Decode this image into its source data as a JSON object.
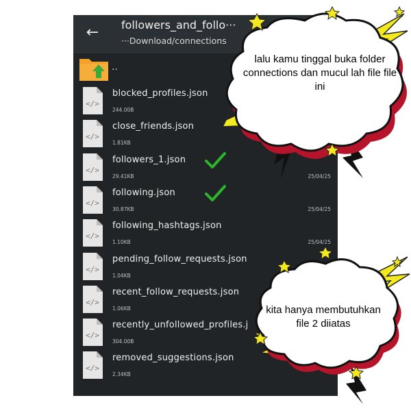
{
  "header": {
    "title": "followers_and_follo···",
    "path": "···Download/connections"
  },
  "parent": {
    "label": ".."
  },
  "files": [
    {
      "name": "blocked_profiles.json",
      "size": "244.00B",
      "date": ""
    },
    {
      "name": "close_friends.json",
      "size": "1.81KB",
      "date": ""
    },
    {
      "name": "followers_1.json",
      "size": "29.41KB",
      "date": "25/04/25",
      "checked": true
    },
    {
      "name": "following.json",
      "size": "30.87KB",
      "date": "25/04/25",
      "checked": true
    },
    {
      "name": "following_hashtags.json",
      "size": "1.10KB",
      "date": "25/04/25"
    },
    {
      "name": "pending_follow_requests.json",
      "size": "1.04KB",
      "date": ""
    },
    {
      "name": "recent_follow_requests.json",
      "size": "1.06KB",
      "date": ""
    },
    {
      "name": "recently_unfollowed_profiles.j",
      "size": "304.00B",
      "date": ""
    },
    {
      "name": "removed_suggestions.json",
      "size": "2.34KB",
      "date": ""
    }
  ],
  "callouts": [
    {
      "text": "lalu kamu tinggal buka folder connections dan mucul lah file file ini"
    },
    {
      "text": "kita hanya membutuhkan file 2 diiatas"
    }
  ],
  "colors": {
    "check": "#2bb52b",
    "bubble_shadow": "#b5142b",
    "bolt": "#f2ea1e",
    "folder": "#f4a22a"
  }
}
